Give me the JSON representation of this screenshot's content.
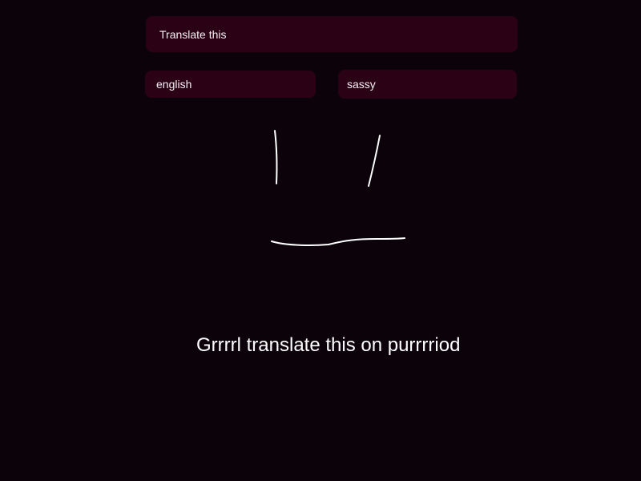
{
  "translate_input": {
    "value": "Translate this"
  },
  "source_language": {
    "value": "english"
  },
  "target_style": {
    "value": "sassy"
  },
  "doodle": {
    "icon": "face-doodle-icon",
    "stroke_color": "#ffffff"
  },
  "output": {
    "text": "Grrrrl translate this on purrrriod"
  },
  "colors": {
    "background": "#0c020a",
    "field_background": "#2b0215",
    "text": "#ffffff"
  }
}
